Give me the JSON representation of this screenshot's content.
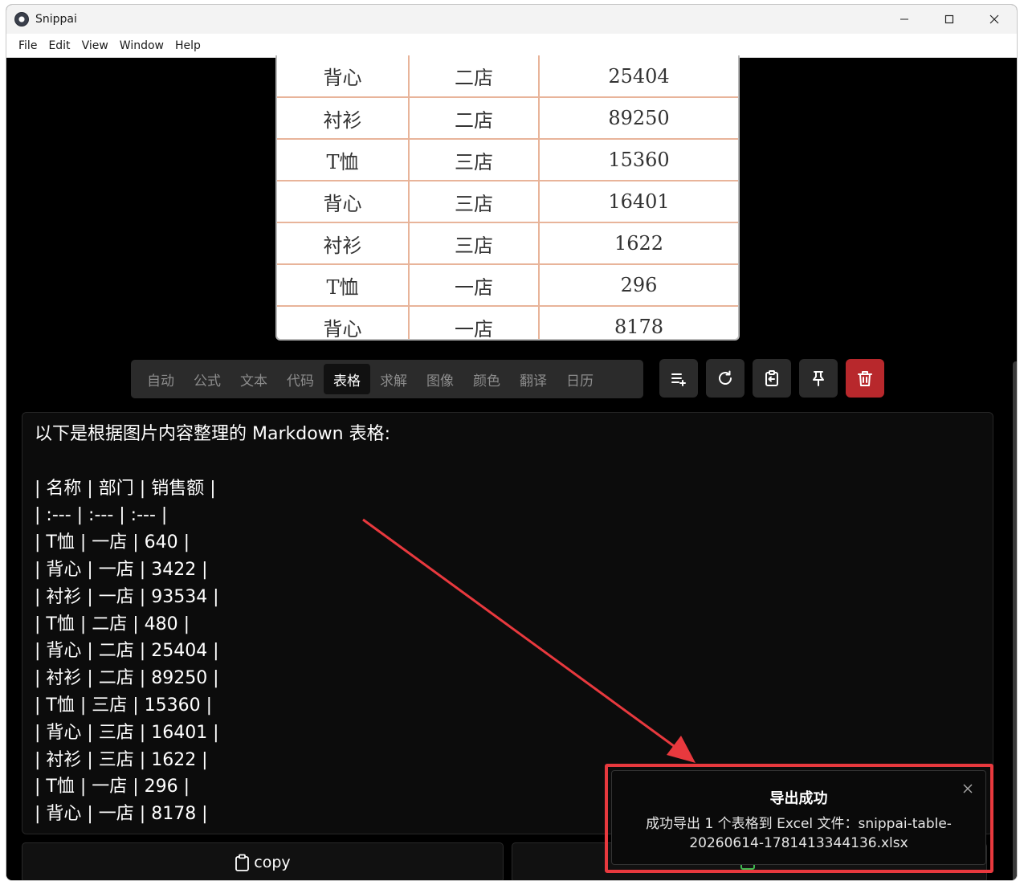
{
  "window": {
    "title": "Snippai"
  },
  "menu": [
    "File",
    "Edit",
    "View",
    "Window",
    "Help"
  ],
  "preview_table": [
    [
      "背心",
      "二店",
      "25404"
    ],
    [
      "衬衫",
      "二店",
      "89250"
    ],
    [
      "T恤",
      "三店",
      "15360"
    ],
    [
      "背心",
      "三店",
      "16401"
    ],
    [
      "衬衫",
      "三店",
      "1622"
    ],
    [
      "T恤",
      "一店",
      "296"
    ],
    [
      "背心",
      "一店",
      "8178"
    ]
  ],
  "modes": [
    "自动",
    "公式",
    "文本",
    "代码",
    "表格",
    "求解",
    "图像",
    "颜色",
    "翻译",
    "日历"
  ],
  "active_mode": "表格",
  "tools": [
    {
      "name": "append-icon",
      "color": "#2b2b2b"
    },
    {
      "name": "refresh-icon",
      "color": "#2b2b2b"
    },
    {
      "name": "paste-icon",
      "color": "#2b2b2b"
    },
    {
      "name": "pin-icon",
      "color": "#2b2b2b"
    },
    {
      "name": "trash-icon",
      "color": "#b8282c"
    }
  ],
  "result": {
    "lines": [
      "以下是根据图片内容整理的 Markdown 表格:",
      "",
      "| 名称 | 部门 | 销售额 |",
      "| :--- | :--- | :--- |",
      "| T恤 | 一店 | 640 |",
      "| 背心 | 一店 | 3422 |",
      "| 衬衫 | 一店 | 93534 |",
      "| T恤 | 二店 | 480 |",
      "| 背心 | 二店 | 25404 |",
      "| 衬衫 | 二店 | 89250 |",
      "| T恤 | 三店 | 15360 |",
      "| 背心 | 三店 | 16401 |",
      "| 衬衫 | 三店 | 1622 |",
      "| T恤 | 一店 | 296 |",
      "| 背心 | 一店 | 8178 |"
    ]
  },
  "buttons": {
    "copy": "copy"
  },
  "toast": {
    "title": "导出成功",
    "message": "成功导出 1 个表格到 Excel 文件：snippai-table-20260614-1781413344136.xlsx",
    "highlight_color": "#e8393e"
  }
}
